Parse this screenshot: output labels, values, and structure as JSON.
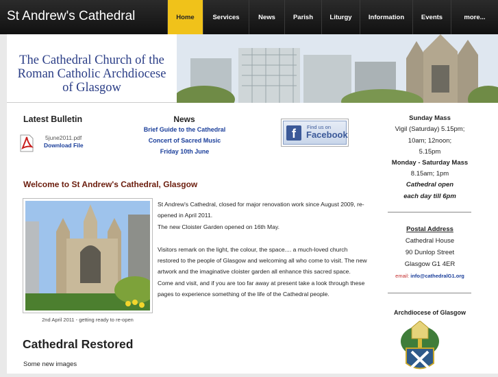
{
  "header": {
    "site_title": "St Andrew's Cathedral",
    "nav": [
      {
        "label": "Home",
        "active": true
      },
      {
        "label": "Services"
      },
      {
        "label": "News"
      },
      {
        "label": "Parish"
      },
      {
        "label": "Liturgy"
      },
      {
        "label": "Information"
      },
      {
        "label": "Events"
      },
      {
        "label": "more..."
      }
    ],
    "active_color": "#f0c21a"
  },
  "banner": {
    "line1": "The Cathedral Church of the",
    "line2": "Roman Catholic Archdiocese",
    "line3": "of Glasgow"
  },
  "bulletin": {
    "title": "Latest Bulletin",
    "file_name": "5june2011.pdf",
    "download_label": "Download File",
    "icon": "pdf-icon"
  },
  "news": {
    "title": "News",
    "links": [
      "Brief Guide to the Cathedral",
      "Concert of Sacred Music",
      "Friday 10th June"
    ]
  },
  "facebook": {
    "find_us": "Find us on",
    "brand": "Facebook",
    "logo_letter": "f",
    "brand_color": "#3b5998"
  },
  "sidebar": {
    "sunday_heading": "Sunday Mass",
    "sunday_line1": "Vigil (Saturday) 5.15pm;",
    "sunday_line2": "10am; 12noon;",
    "sunday_line3": "5.15pm",
    "weekday_heading": "Monday - Saturday Mass",
    "weekday_times": "8.15am; 1pm",
    "open_line1": "Cathedral open",
    "open_line2": "each day till 6pm",
    "postal_heading": "Postal Address",
    "address_line1": "Cathedral House",
    "address_line2": "90 Dunlop Street",
    "address_line3": "Glasgow G1 4ER",
    "email_label": "email:",
    "email_value": "info@cathedralG1.org",
    "archdiocese_heading": "Archdiocese of Glasgow"
  },
  "main": {
    "welcome_heading": "Welcome to St Andrew's Cathedral, Glasgow",
    "photo_caption": "2nd April 2011 - getting ready to re-open",
    "para1_line1": "St Andrew's Cathedral, closed for major renovation work since August 2009,  re-",
    "para1_line2": "opened in April 2011.",
    "para1_line3": "The new Cloister Garden opened on 16th May.",
    "para2_line1": "Visitors remark on the light, the colour, the space.... a much-loved church",
    "para2_line2": "restored to the people of Glasgow and welcoming all who come to visit. The new",
    "para2_line3": "artwork and the imaginative cloister garden all enhance this sacred space.",
    "para2_line4": "Come and visit, and if you are too far away at present take a look through these",
    "para2_line5": "pages to experience something of the life of the Cathedral people.",
    "restored_heading": "Cathedral Restored",
    "new_images": "Some new images"
  }
}
